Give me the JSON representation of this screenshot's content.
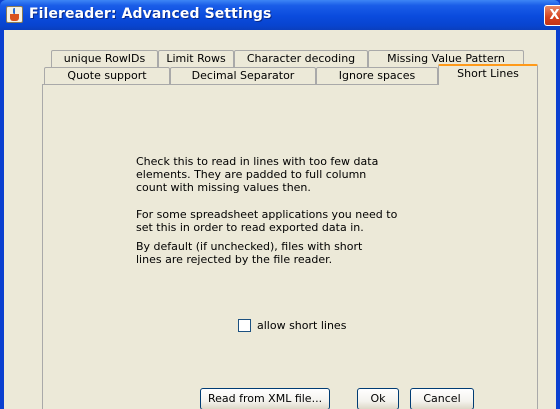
{
  "window": {
    "title": "Filereader: Advanced Settings",
    "close_glyph": "X"
  },
  "tabs_row1": [
    {
      "label": "unique RowIDs"
    },
    {
      "label": "Limit Rows"
    },
    {
      "label": "Character decoding"
    },
    {
      "label": "Missing Value Pattern"
    }
  ],
  "tabs_row2": [
    {
      "label": "Quote support"
    },
    {
      "label": "Decimal Separator"
    },
    {
      "label": "Ignore spaces"
    },
    {
      "label": "Short Lines"
    }
  ],
  "selected_tab": "Short Lines",
  "panel": {
    "lines": [
      "Check this to read in lines with too few data",
      "elements. They are padded to full column",
      "count with missing values then.",
      "For some spreadsheet applications you need to",
      "set this in order to read exported data in.",
      "By default (if unchecked), files with short",
      "lines are rejected by the file reader."
    ],
    "checkbox_label": "allow short lines",
    "checkbox_checked": false
  },
  "buttons": {
    "read_xml": "Read from XML file...",
    "ok": "Ok",
    "cancel": "Cancel"
  },
  "icons": {
    "app": "java-cup-icon",
    "close": "close-icon"
  },
  "colors": {
    "titlebar": "#0a4bdd",
    "dialog_bg": "#ece9d8",
    "selected_tab_accent": "#ff9a1a"
  }
}
